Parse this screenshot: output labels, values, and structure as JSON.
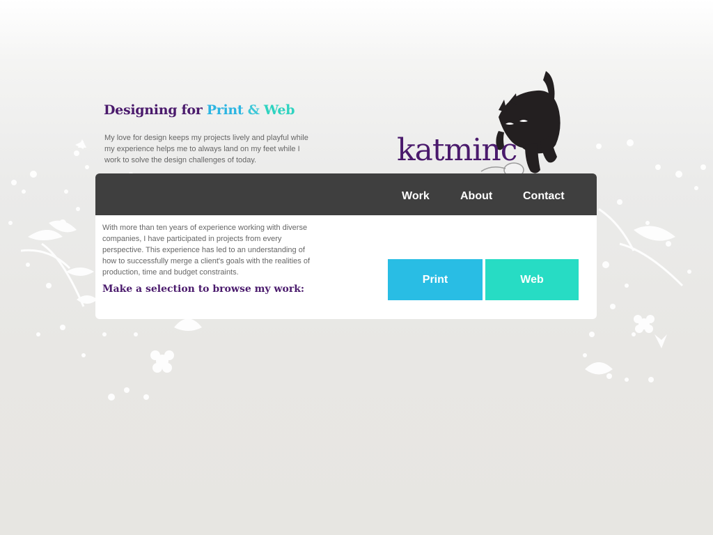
{
  "header": {
    "headline_prefix": "Designing for",
    "headline_print": "Print",
    "headline_amp": "&",
    "headline_web": "Web",
    "intro": "My love for design keeps my projects lively and playful while my experience helps me to always land on my feet while I work to solve the design challenges of today."
  },
  "logo": {
    "text": "katminc"
  },
  "nav": {
    "items": [
      {
        "label": "Work"
      },
      {
        "label": "About"
      },
      {
        "label": "Contact"
      }
    ]
  },
  "main": {
    "body": "With more than ten years of experience working with diverse companies, I have participated in projects from every perspective. This experience has led to an understanding of how to successfully merge a client's goals with the realities of production, time and budget constraints.",
    "selection_prompt": "Make a selection to browse my work:",
    "buttons": [
      {
        "label": "Print"
      },
      {
        "label": "Web"
      }
    ]
  },
  "colors": {
    "purple": "#4a1a6c",
    "print_blue": "#29bde4",
    "web_teal": "#27dcc4",
    "nav_bg": "#3f3f3f"
  }
}
